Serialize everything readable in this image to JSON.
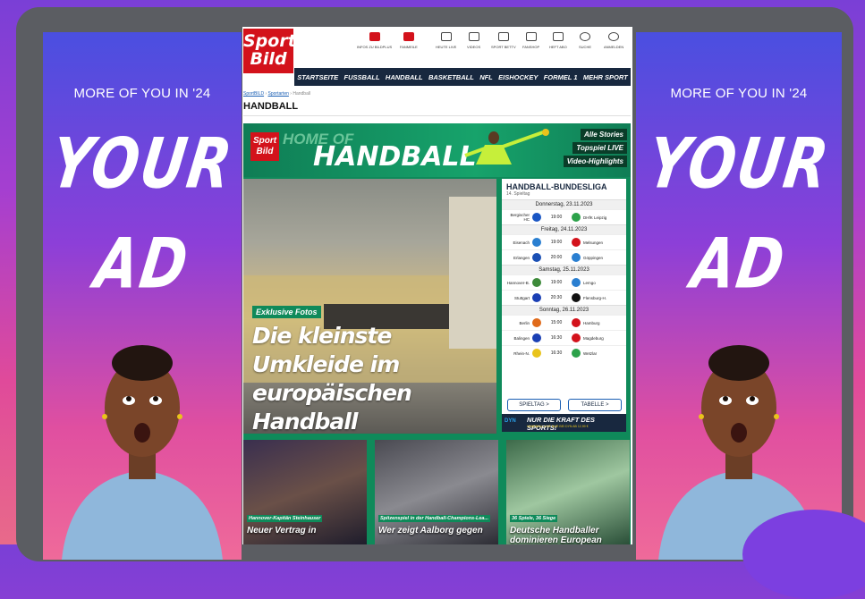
{
  "ad_panels": {
    "tagline": "MORE OF YOU IN '24",
    "big_line1": "YOUR",
    "big_line2": "AD"
  },
  "site": {
    "logo_top": "Sport",
    "logo_bottom": "Bild",
    "utility": [
      {
        "label": "INFOS ZU BILDPLUS",
        "icon": "bildplus-icon"
      },
      {
        "label": "FANMEILE",
        "icon": "fanmeile-icon"
      },
      {
        "label": "HEUTE LIVE",
        "icon": "calendar-icon"
      },
      {
        "label": "VIDEOS",
        "icon": "play-icon"
      },
      {
        "label": "SPORT BETTV",
        "icon": "tv-icon"
      },
      {
        "label": "FANSHOP",
        "icon": "cart-icon"
      },
      {
        "label": "HEFT ABO",
        "icon": "magazine-icon"
      },
      {
        "label": "SUCHE",
        "icon": "search-icon"
      },
      {
        "label": "ANMELDEN",
        "icon": "user-icon"
      }
    ],
    "nav": [
      "STARTSEITE",
      "FUSSBALL",
      "HANDBALL",
      "BASKETBALL",
      "NFL",
      "EISHOCKEY",
      "FORMEL 1",
      "MEHR SPORT"
    ],
    "breadcrumb": [
      "SportBILD",
      "Sportarten",
      "Handball"
    ],
    "page_title": "HANDBALL"
  },
  "banner": {
    "home_of": "HOME OF",
    "title": "HANDBALL",
    "links": [
      "Alle Stories",
      "Topspiel LIVE",
      "Video-Highlights"
    ]
  },
  "lead": {
    "kicker": "Exklusive Fotos",
    "headline": "Die kleinste Umkleide im europäischen Handball"
  },
  "league": {
    "title": "HANDBALL-BUNDESLIGA",
    "matchday": "14. Spieltag",
    "days": [
      {
        "date": "Donnerstag, 23.11.2023",
        "matches": [
          {
            "home": "Bergischer HC",
            "time": "19:00",
            "away": "DHfK Leipzig",
            "c1": "#1a56c4",
            "c2": "#2ca24a"
          }
        ]
      },
      {
        "date": "Freitag, 24.11.2023",
        "matches": [
          {
            "home": "Eisenach",
            "time": "19:00",
            "away": "Melsungen",
            "c1": "#2a7fd1",
            "c2": "#d3121b"
          },
          {
            "home": "Erlangen",
            "time": "20:00",
            "away": "Göppingen",
            "c1": "#1a4fb4",
            "c2": "#2a7fd1"
          }
        ]
      },
      {
        "date": "Samstag, 25.11.2023",
        "matches": [
          {
            "home": "Hannover-B.",
            "time": "19:00",
            "away": "Lemgo",
            "c1": "#3d8a3a",
            "c2": "#2a7fd1"
          },
          {
            "home": "Stuttgart",
            "time": "20:30",
            "away": "Flensburg-H.",
            "c1": "#1a3fb4",
            "c2": "#111111"
          }
        ]
      },
      {
        "date": "Sonntag, 26.11.2023",
        "matches": [
          {
            "home": "Berlin",
            "time": "15:00",
            "away": "Hamburg",
            "c1": "#e06a1a",
            "c2": "#d3121b"
          },
          {
            "home": "Balingen",
            "time": "16:30",
            "away": "Magdeburg",
            "c1": "#1a3fb4",
            "c2": "#d3121b"
          },
          {
            "home": "Rhein-N.",
            "time": "16:30",
            "away": "Wetzlar",
            "c1": "#e9c31b",
            "c2": "#2ca24a"
          }
        ]
      }
    ],
    "btn_spieltag": "SPIELTAG >",
    "btn_tabelle": "TABELLE >"
  },
  "promo": {
    "logo": "DYN",
    "line1": "NUR DIE KRAFT DES SPORTS!",
    "line2": "HANDBALL LIVE NUR BEI DYN AB 12,99 €"
  },
  "cards": [
    {
      "kicker": "Hannover-Kapitän Steinhauser",
      "headline": "Neuer Vertrag in"
    },
    {
      "kicker": "Spitzenspiel in der Handball-Champions-Lea...",
      "headline": "Wer zeigt Aalborg gegen"
    },
    {
      "kicker": "36 Spiele, 36 Siege",
      "headline": "Deutsche Handballer dominieren European"
    }
  ],
  "colors": {
    "brand_red": "#d3121b",
    "nav_navy": "#18283f",
    "handball_green": "#0f8a5a"
  }
}
